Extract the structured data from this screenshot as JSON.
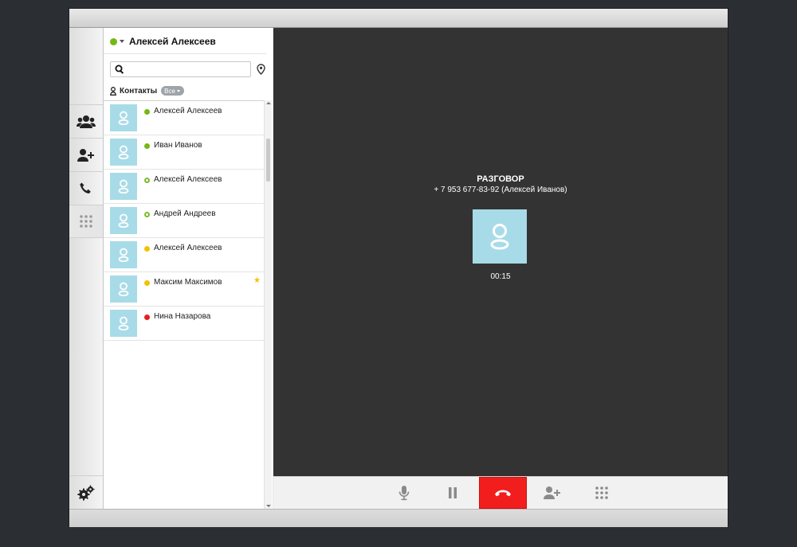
{
  "user": {
    "name": "Алексей Алексеев",
    "status_color": "#74b816"
  },
  "search": {
    "value": "",
    "placeholder": ""
  },
  "contacts_header": {
    "label": "Контакты",
    "filter": "Все"
  },
  "contacts": [
    {
      "name": "Алексей Алексеев",
      "status": "online",
      "color": "#74b816"
    },
    {
      "name": "Иван Иванов",
      "status": "online",
      "color": "#74b816"
    },
    {
      "name": "Алексей Алексеев",
      "status": "online-hollow",
      "color": "#74b816"
    },
    {
      "name": "Андрей Андреев",
      "status": "online-hollow",
      "color": "#74b816"
    },
    {
      "name": "Алексей Алексеев",
      "status": "away",
      "color": "#f2c200"
    },
    {
      "name": "Максим Максимов",
      "status": "away",
      "color": "#f2c200",
      "favorite": true
    },
    {
      "name": "Нина Назарова",
      "status": "busy",
      "color": "#e32020"
    }
  ],
  "call": {
    "title": "РАЗГОВОР",
    "number": "+ 7 953 677-83-92 (Алексей Иванов)",
    "timer": "00:15"
  },
  "nav": [
    "contacts-group-icon",
    "add-contact-icon",
    "phone-icon",
    "dialpad-icon",
    "settings-icon"
  ],
  "controls": [
    "microphone-icon",
    "pause-icon",
    "hangup-icon",
    "add-participant-icon",
    "dialpad-icon"
  ],
  "colors": {
    "accent_red": "#f21d1d",
    "avatar_bg": "#a8dbe8",
    "call_bg": "#333333"
  }
}
